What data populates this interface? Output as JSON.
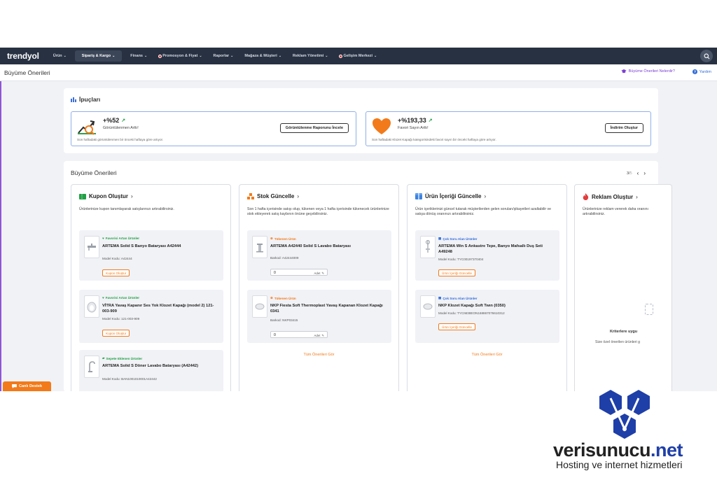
{
  "topnav": {
    "logo": "trendyol",
    "items": [
      {
        "label": "Ürün"
      },
      {
        "label": "Sipariş & Kargo"
      },
      {
        "label": "Finans"
      },
      {
        "label": "Promosyon & Fiyat"
      },
      {
        "label": "Raporlar"
      },
      {
        "label": "Mağaza & Müşteri"
      },
      {
        "label": "Reklam Yönetimi"
      },
      {
        "label": "Gelişim Merkezi"
      }
    ]
  },
  "subheader": {
    "title": "Büyüme Önerileri",
    "whatis_link": "Büyüme Önerileri Nelerdir?",
    "help_link": "Yardım"
  },
  "tips": {
    "title": "İpuçları",
    "cards": [
      {
        "percent": "+%52",
        "label": "Görüntülenmen Arttı!",
        "desc": "Son haftadaki görüntülenmen bir önceki haftaya göre artıyor.",
        "button": "Görüntülenme Raporunu İncele"
      },
      {
        "percent": "+%193,33",
        "label": "Favori Sayın Arttı!",
        "desc": "Son haftadaki Klozet Kapağı kategorisindeki favori sayın bir önceki haftaya göre artıyor.",
        "button": "İndirim Oluştur"
      }
    ]
  },
  "growth": {
    "title": "Büyüme Önerileri",
    "pager": {
      "current": "3/",
      "total": "5"
    },
    "see_all": "Tüm Önerileri Gör",
    "cards": [
      {
        "title": "Kupon Oluştur",
        "desc": "Ürünlerinize kupon tanımlayarak satışlarınızı artırabilirsiniz.",
        "products": [
          {
            "tag": "Favorisi Artan Ürünler",
            "name": "ARTEMA Solid S Banyo Bataryası A42444",
            "meta_label": "Model Kodu:",
            "meta_value": "A42444",
            "button": "Kupon Oluştur"
          },
          {
            "tag": "Favorisi Artan Ürünler",
            "name": "VİTRA Yavaş Kapanır Ses Yok Klozet Kapağı (model 2) 121-003-909",
            "meta_label": "Model Kodu:",
            "meta_value": "121-003-909",
            "button": "Kupon Oluştur"
          },
          {
            "tag": "Sepete Eklenen Ürünler",
            "name": "ARTEMA Solid S Döner Lavabo Bataryası (A42442)",
            "meta_label": "Model Kodu:",
            "meta_value": "BAN1001010001A42442"
          }
        ]
      },
      {
        "title": "Stok Güncelle",
        "desc": "Son 1 hafta içerisinde satışı olup, tükenen veya 1 hafta içerisinde tükenecek ürünlerinize stok ekleyerek satış kaybının önüne geçebilirsiniz.",
        "products": [
          {
            "tag": "Tükenen Ürün",
            "name": "ARTEMA A42440 Solid S Lavabo Bataryası",
            "meta_label": "Barkod:",
            "meta_value": "A42444009",
            "qty": "0",
            "unit": "Adet"
          },
          {
            "tag": "Tükenen Ürün",
            "name": "NKP Fiesta Soft Thermoplast Yavaş Kapanan Klozet Kapağı 0341",
            "meta_label": "Barkod:",
            "meta_value": "NKP03415",
            "qty": "0",
            "unit": "Adet"
          }
        ]
      },
      {
        "title": "Ürün İçeriği Güncelle",
        "desc": "Ürün içeriklerinizi güncel tutarak müşterilerden gelen soruları/şikayetleri azaltabilir ve satışa dönüş oranınızı artırabilirsiniz.",
        "products": [
          {
            "tag": "Çok Soru Alan Ürünler",
            "name": "ARTEMA Win S Ankastre Tepe, Banyo Mafsallı Duş Seti A49248",
            "meta_label": "Model Kodu:",
            "meta_value": "TYC00197370404",
            "button": "Ürün İçeriği Güncelle"
          },
          {
            "tag": "Çok Soru Alan Ürünler",
            "name": "NKP Klozet Kapağı Soft Twın (0350)",
            "meta_label": "Model Kodu:",
            "meta_value": "TYCIM38EON168867076610312",
            "button": "Ürün İçeriği Güncelle"
          }
        ]
      },
      {
        "title": "Reklam Oluştur",
        "desc": "Ürünlerinize reklam vererek daha oranını artırabilirsiniz.",
        "empty_title": "Kriterlere uygu",
        "empty_sub": "Size özel önerilen ürünleri g"
      }
    ]
  },
  "live_support": "Canlı Destek",
  "brand": {
    "name_main": "verisunucu",
    "name_tld": ".net",
    "tagline": "Hosting ve internet hizmetleri"
  },
  "colors": {
    "nav_bg": "#273142",
    "accent_orange": "#f27a1a",
    "tip_border": "#8fb0e8",
    "purple": "#7b3fd4",
    "green": "#22a046",
    "blue": "#2f6ad8"
  }
}
